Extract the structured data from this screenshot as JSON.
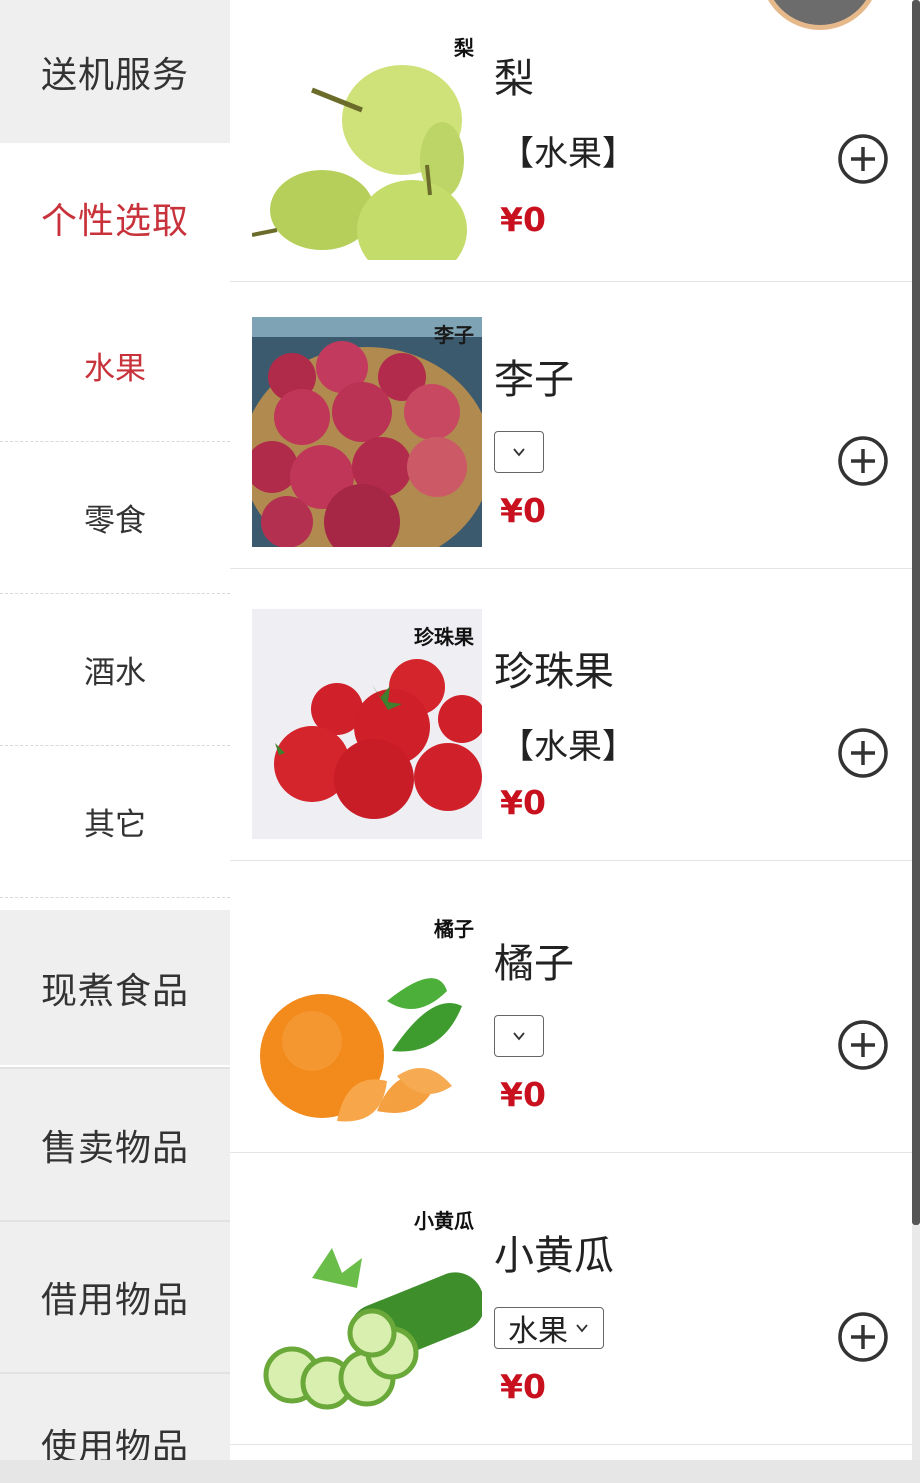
{
  "sidebar": {
    "categories": [
      {
        "label": "送机服务"
      },
      {
        "label": "个性选取"
      },
      {
        "label": "现煮食品"
      },
      {
        "label": "售卖物品"
      },
      {
        "label": "借用物品"
      },
      {
        "label": "使用物品"
      }
    ],
    "subcategories": [
      {
        "label": "水果"
      },
      {
        "label": "零食"
      },
      {
        "label": "酒水"
      },
      {
        "label": "其它"
      }
    ]
  },
  "products": [
    {
      "name": "梨",
      "image_tag": "梨",
      "category_text": "【水果】",
      "price": "¥0"
    },
    {
      "name": "李子",
      "image_tag": "李子",
      "select_value": "",
      "price": "¥0"
    },
    {
      "name": "珍珠果",
      "image_tag": "珍珠果",
      "category_text": "【水果】",
      "price": "¥0"
    },
    {
      "name": "橘子",
      "image_tag": "橘子",
      "select_value": "",
      "price": "¥0"
    },
    {
      "name": "小黄瓜",
      "image_tag": "小黄瓜",
      "select_value": "水果",
      "price": "¥0"
    }
  ],
  "colors": {
    "accent": "#c8323a",
    "price": "#c8101e",
    "sidebar_bg": "#efefef"
  },
  "icons": {
    "add": "plus-circle-icon",
    "dropdown": "chevron-down-icon"
  }
}
